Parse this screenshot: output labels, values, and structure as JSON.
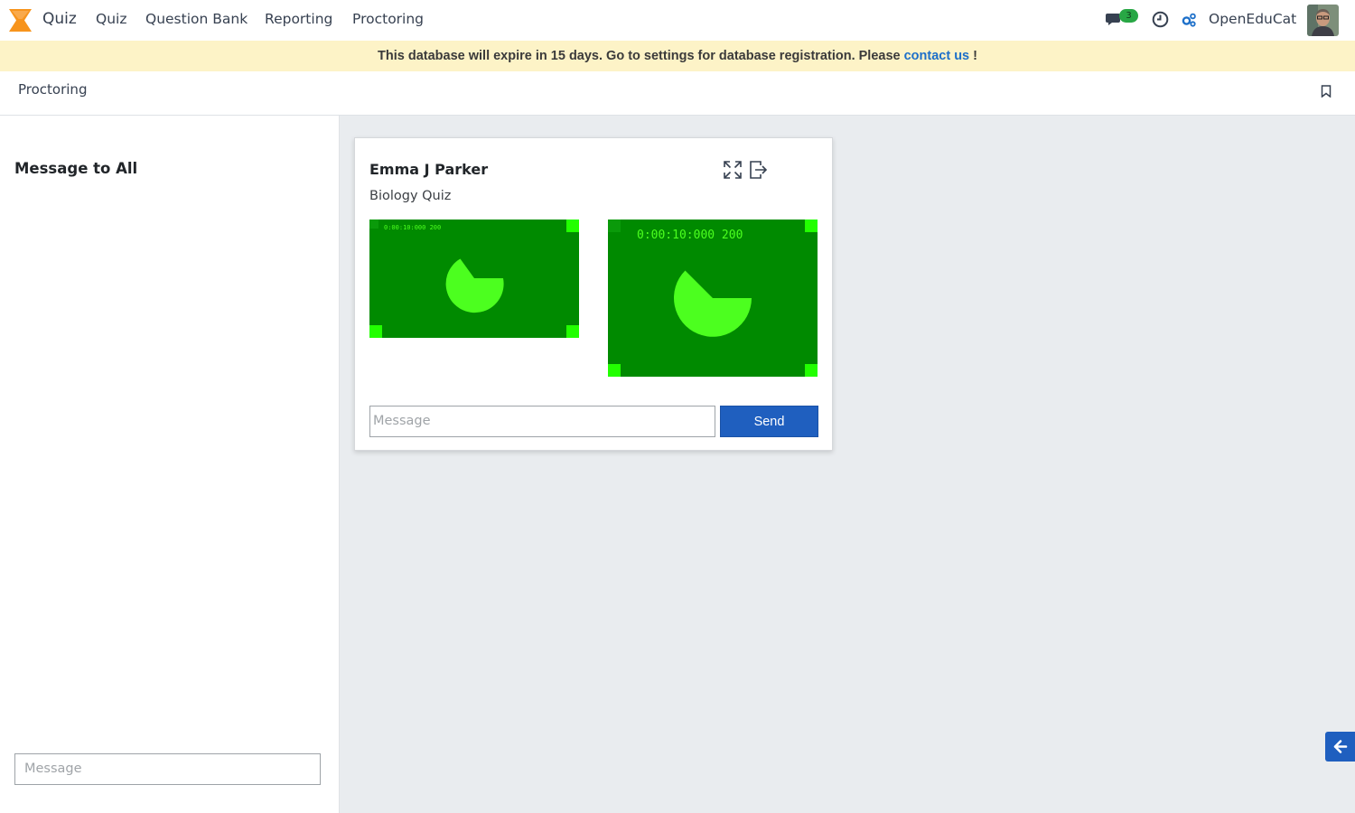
{
  "navbar": {
    "app_name": "Quiz",
    "menu": [
      "Quiz",
      "Question Bank",
      "Reporting",
      "Proctoring"
    ],
    "messages_count": "3",
    "user_name": "OpenEduCat",
    "icons": [
      "chat-icon",
      "clock-icon",
      "settings-icon"
    ]
  },
  "banner": {
    "text": "This database will expire in 15 days. Go to settings for database registration. Please ",
    "link": "contact us",
    "suffix": " !"
  },
  "control": {
    "breadcrumb": "Proctoring"
  },
  "left_panel": {
    "title": "Message to All",
    "input_placeholder": "Message"
  },
  "card": {
    "student": "Emma J Parker",
    "quiz": "Biology Quiz",
    "video_timestamp": "0:00:10:000 200",
    "input_placeholder": "Message",
    "send_label": "Send"
  },
  "colors": {
    "accent": "#1f5fbf",
    "banner_bg": "#fdf3c7",
    "video_bg": "#008a00",
    "video_fg": "#4cff1f",
    "badge": "#28a745"
  }
}
